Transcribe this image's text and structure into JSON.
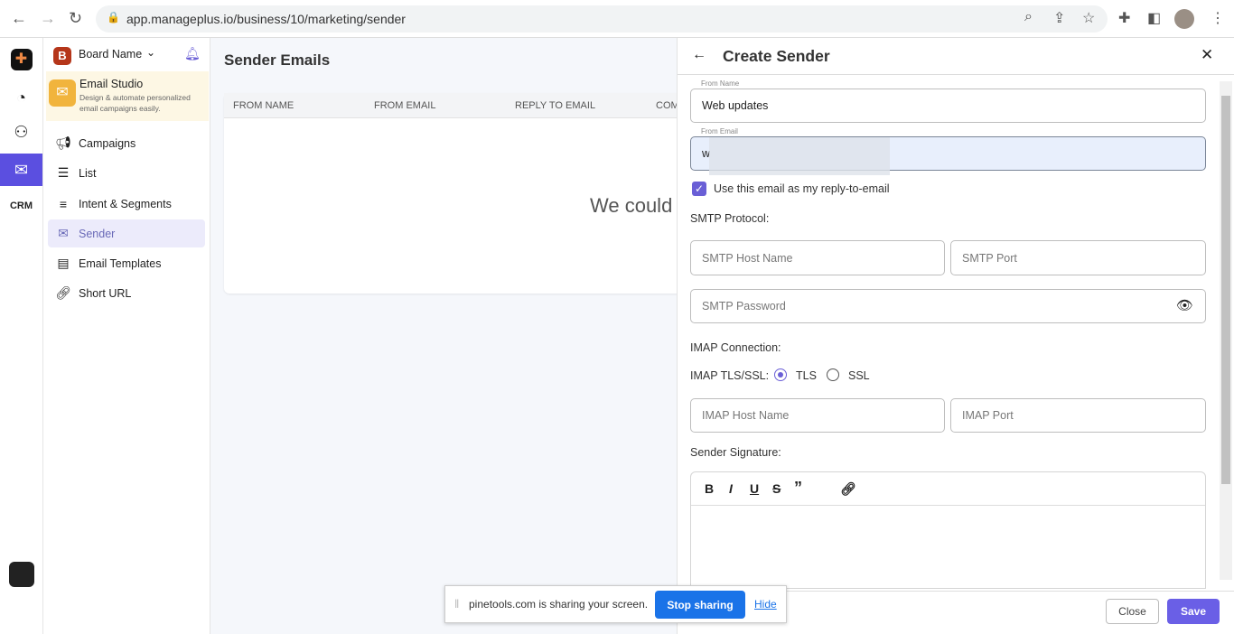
{
  "browser": {
    "url": "app.manageplus.io/business/10/marketing/sender"
  },
  "rail": {
    "items": [
      "logo",
      "dashboard",
      "network",
      "email-studio",
      "crm"
    ],
    "crm_label": "CRM"
  },
  "sidebar": {
    "board_initial": "B",
    "board_name": "Board Name",
    "studio_title": "Email Studio",
    "studio_desc_1": "Design & automate personalized",
    "studio_desc_2": "email campaigns easily.",
    "items": [
      {
        "label": "Campaigns",
        "icon": "megaphone"
      },
      {
        "label": "List",
        "icon": "list"
      },
      {
        "label": "Intent & Segments",
        "icon": "segments"
      },
      {
        "label": "Sender",
        "icon": "sender",
        "active": true
      },
      {
        "label": "Email Templates",
        "icon": "template"
      },
      {
        "label": "Short URL",
        "icon": "link"
      }
    ]
  },
  "main": {
    "title": "Sender Emails",
    "columns": [
      "FROM NAME",
      "FROM EMAIL",
      "REPLY TO EMAIL",
      "COM"
    ],
    "empty_text": "We could"
  },
  "panel": {
    "title": "Create Sender",
    "from_name_label": "From Name",
    "from_name_value": "Web updates",
    "from_email_label": "From Email",
    "from_email_value": "w",
    "reply_checkbox": "Use this email as my reply-to-email",
    "reply_checked": true,
    "smtp_label": "SMTP Protocol:",
    "smtp_host_ph": "SMTP Host Name",
    "smtp_port_ph": "SMTP Port",
    "smtp_password_ph": "SMTP Password",
    "imap_label": "IMAP Connection:",
    "imap_tls_label": "IMAP TLS/SSL:",
    "tls": "TLS",
    "ssl": "SSL",
    "selected": "TLS",
    "imap_host_ph": "IMAP Host Name",
    "imap_port_ph": "IMAP Port",
    "signature_label": "Sender Signature:",
    "close": "Close",
    "save": "Save"
  },
  "share_bar": {
    "text": "pinetools.com is sharing your screen.",
    "stop": "Stop sharing",
    "hide": "Hide"
  },
  "colors": {
    "accent": "#6a5fd6",
    "share_blue": "#1a73e8"
  }
}
